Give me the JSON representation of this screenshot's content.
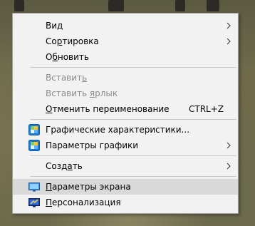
{
  "menu": {
    "items": [
      {
        "pre": "Ви",
        "ul": "д",
        "post": "",
        "submenu": true,
        "icon": "",
        "disabled": false
      },
      {
        "pre": "Со",
        "ul": "р",
        "post": "тировка",
        "submenu": true,
        "icon": "",
        "disabled": false
      },
      {
        "pre": "О",
        "ul": "б",
        "post": "новить",
        "submenu": false,
        "icon": "",
        "disabled": false
      },
      {
        "pre": "Вставит",
        "ul": "ь",
        "post": "",
        "submenu": false,
        "icon": "",
        "disabled": true
      },
      {
        "pre": "Вставить ",
        "ul": "я",
        "post": "рлык",
        "submenu": false,
        "icon": "",
        "disabled": true
      },
      {
        "pre": "",
        "ul": "О",
        "post": "тменить переименование",
        "shortcut": "CTRL+Z",
        "submenu": false,
        "icon": "",
        "disabled": false
      },
      {
        "pre": "Графические характеристики...",
        "ul": "",
        "post": "",
        "submenu": false,
        "icon": "intel-graphics-icon",
        "disabled": false
      },
      {
        "pre": "Параметры графики",
        "ul": "",
        "post": "",
        "submenu": true,
        "icon": "intel-graphics-icon",
        "disabled": false
      },
      {
        "pre": "Созд",
        "ul": "а",
        "post": "ть",
        "submenu": true,
        "icon": "",
        "disabled": false
      },
      {
        "pre": "",
        "ul": "П",
        "post": "араметры экрана",
        "submenu": false,
        "icon": "display-settings-icon",
        "disabled": false,
        "highlighted": true
      },
      {
        "pre": "",
        "ul": "П",
        "post": "ерсонализация",
        "submenu": false,
        "icon": "personalization-icon",
        "disabled": false
      }
    ]
  },
  "colors": {
    "menu_bg": "#f2f2f2",
    "highlight": "#d9d9d9",
    "disabled_text": "#8a8a8a",
    "separator": "#c8c8c8"
  }
}
